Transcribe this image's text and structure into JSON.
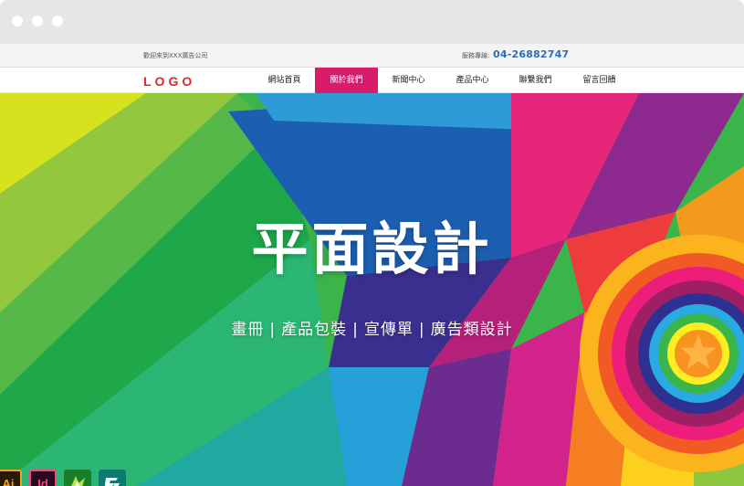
{
  "browser": {
    "window_dots": [
      "close",
      "minimize",
      "maximize"
    ]
  },
  "topbar": {
    "welcome": "歡迎來到XXX廣告公司",
    "hotline_label": "服務專線:",
    "hotline_number": "04-26882747"
  },
  "header": {
    "logo": "LOGO",
    "nav": [
      {
        "label": "網站首頁",
        "active": false
      },
      {
        "label": "關於我們",
        "active": true
      },
      {
        "label": "新聞中心",
        "active": false
      },
      {
        "label": "產品中心",
        "active": false
      },
      {
        "label": "聯繫我們",
        "active": false
      },
      {
        "label": "留言回饋",
        "active": false
      }
    ]
  },
  "hero": {
    "title": "平面設計",
    "subtitle_items": [
      "畫冊",
      "產品包裝",
      "宣傳單",
      "廣告類設計"
    ],
    "separator": "|"
  },
  "software_icons": [
    {
      "name": "illustrator",
      "label": "Ai"
    },
    {
      "name": "indesign",
      "label": "Id"
    },
    {
      "name": "coreldraw",
      "label": ""
    },
    {
      "name": "freehand",
      "label": ""
    }
  ],
  "colors": {
    "nav_active": "#d81b6a",
    "logo": "#e0262c",
    "hotline": "#2f6db5"
  }
}
